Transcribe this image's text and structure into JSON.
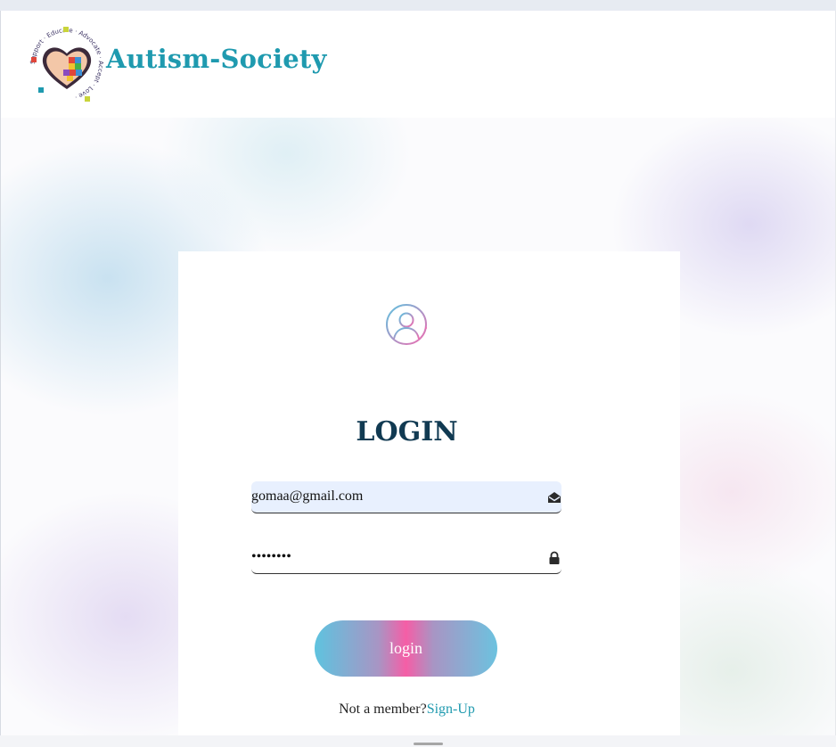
{
  "header": {
    "brand": "Autism-Society",
    "logo_words": [
      "Support",
      "Educate",
      "Advocate",
      "Accept",
      "Love"
    ]
  },
  "login_card": {
    "title": "LOGIN",
    "email_value": "gomaa@gmail.com",
    "password_value": "••••••••",
    "login_label": "login",
    "not_member_text": "Not a member?",
    "signup_label": "Sign-Up"
  },
  "icons": {
    "avatar": "user-circle-icon",
    "email": "envelope-open-icon",
    "password": "lock-icon"
  },
  "colors": {
    "brand": "#1f9aaf",
    "title": "#113a52",
    "button_gradient": [
      "#5ec3df",
      "#f55ea6",
      "#6cc2df"
    ],
    "email_field_bg": "#e8f0fe"
  }
}
